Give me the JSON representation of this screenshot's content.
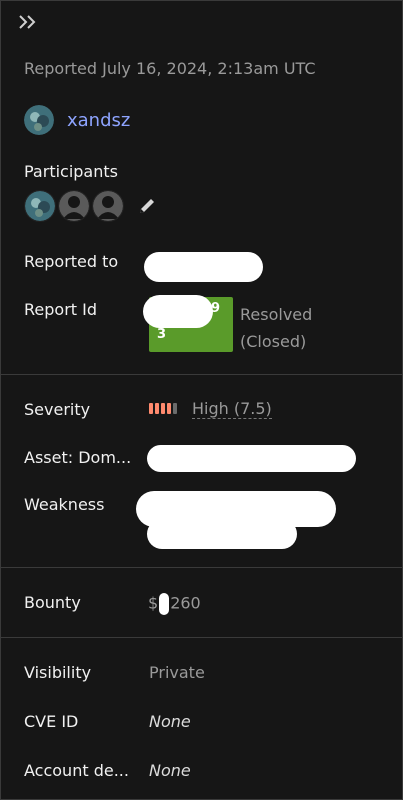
{
  "header": {
    "reported_text": "Reported July 16, 2024, 2:13am UTC"
  },
  "reporter": {
    "username": "xandsz"
  },
  "participants": {
    "label": "Participants"
  },
  "reported_to": {
    "label": "Reported to"
  },
  "report": {
    "label": "Report Id",
    "id_fragment_top": "9",
    "id_fragment_bottom": "3",
    "status_line1": "Resolved",
    "status_line2": "(Closed)",
    "status_color": "#5a9b2a"
  },
  "severity": {
    "label": "Severity",
    "text": "High (7.5)",
    "color": "#ff8a6e"
  },
  "asset": {
    "label": "Asset: Dom..."
  },
  "weakness": {
    "label": "Weakness"
  },
  "bounty": {
    "label": "Bounty",
    "prefix": "$",
    "suffix": "260"
  },
  "visibility": {
    "label": "Visibility",
    "value": "Private"
  },
  "cve": {
    "label": "CVE ID",
    "value": "None"
  },
  "account": {
    "label": "Account de...",
    "value": "None"
  }
}
